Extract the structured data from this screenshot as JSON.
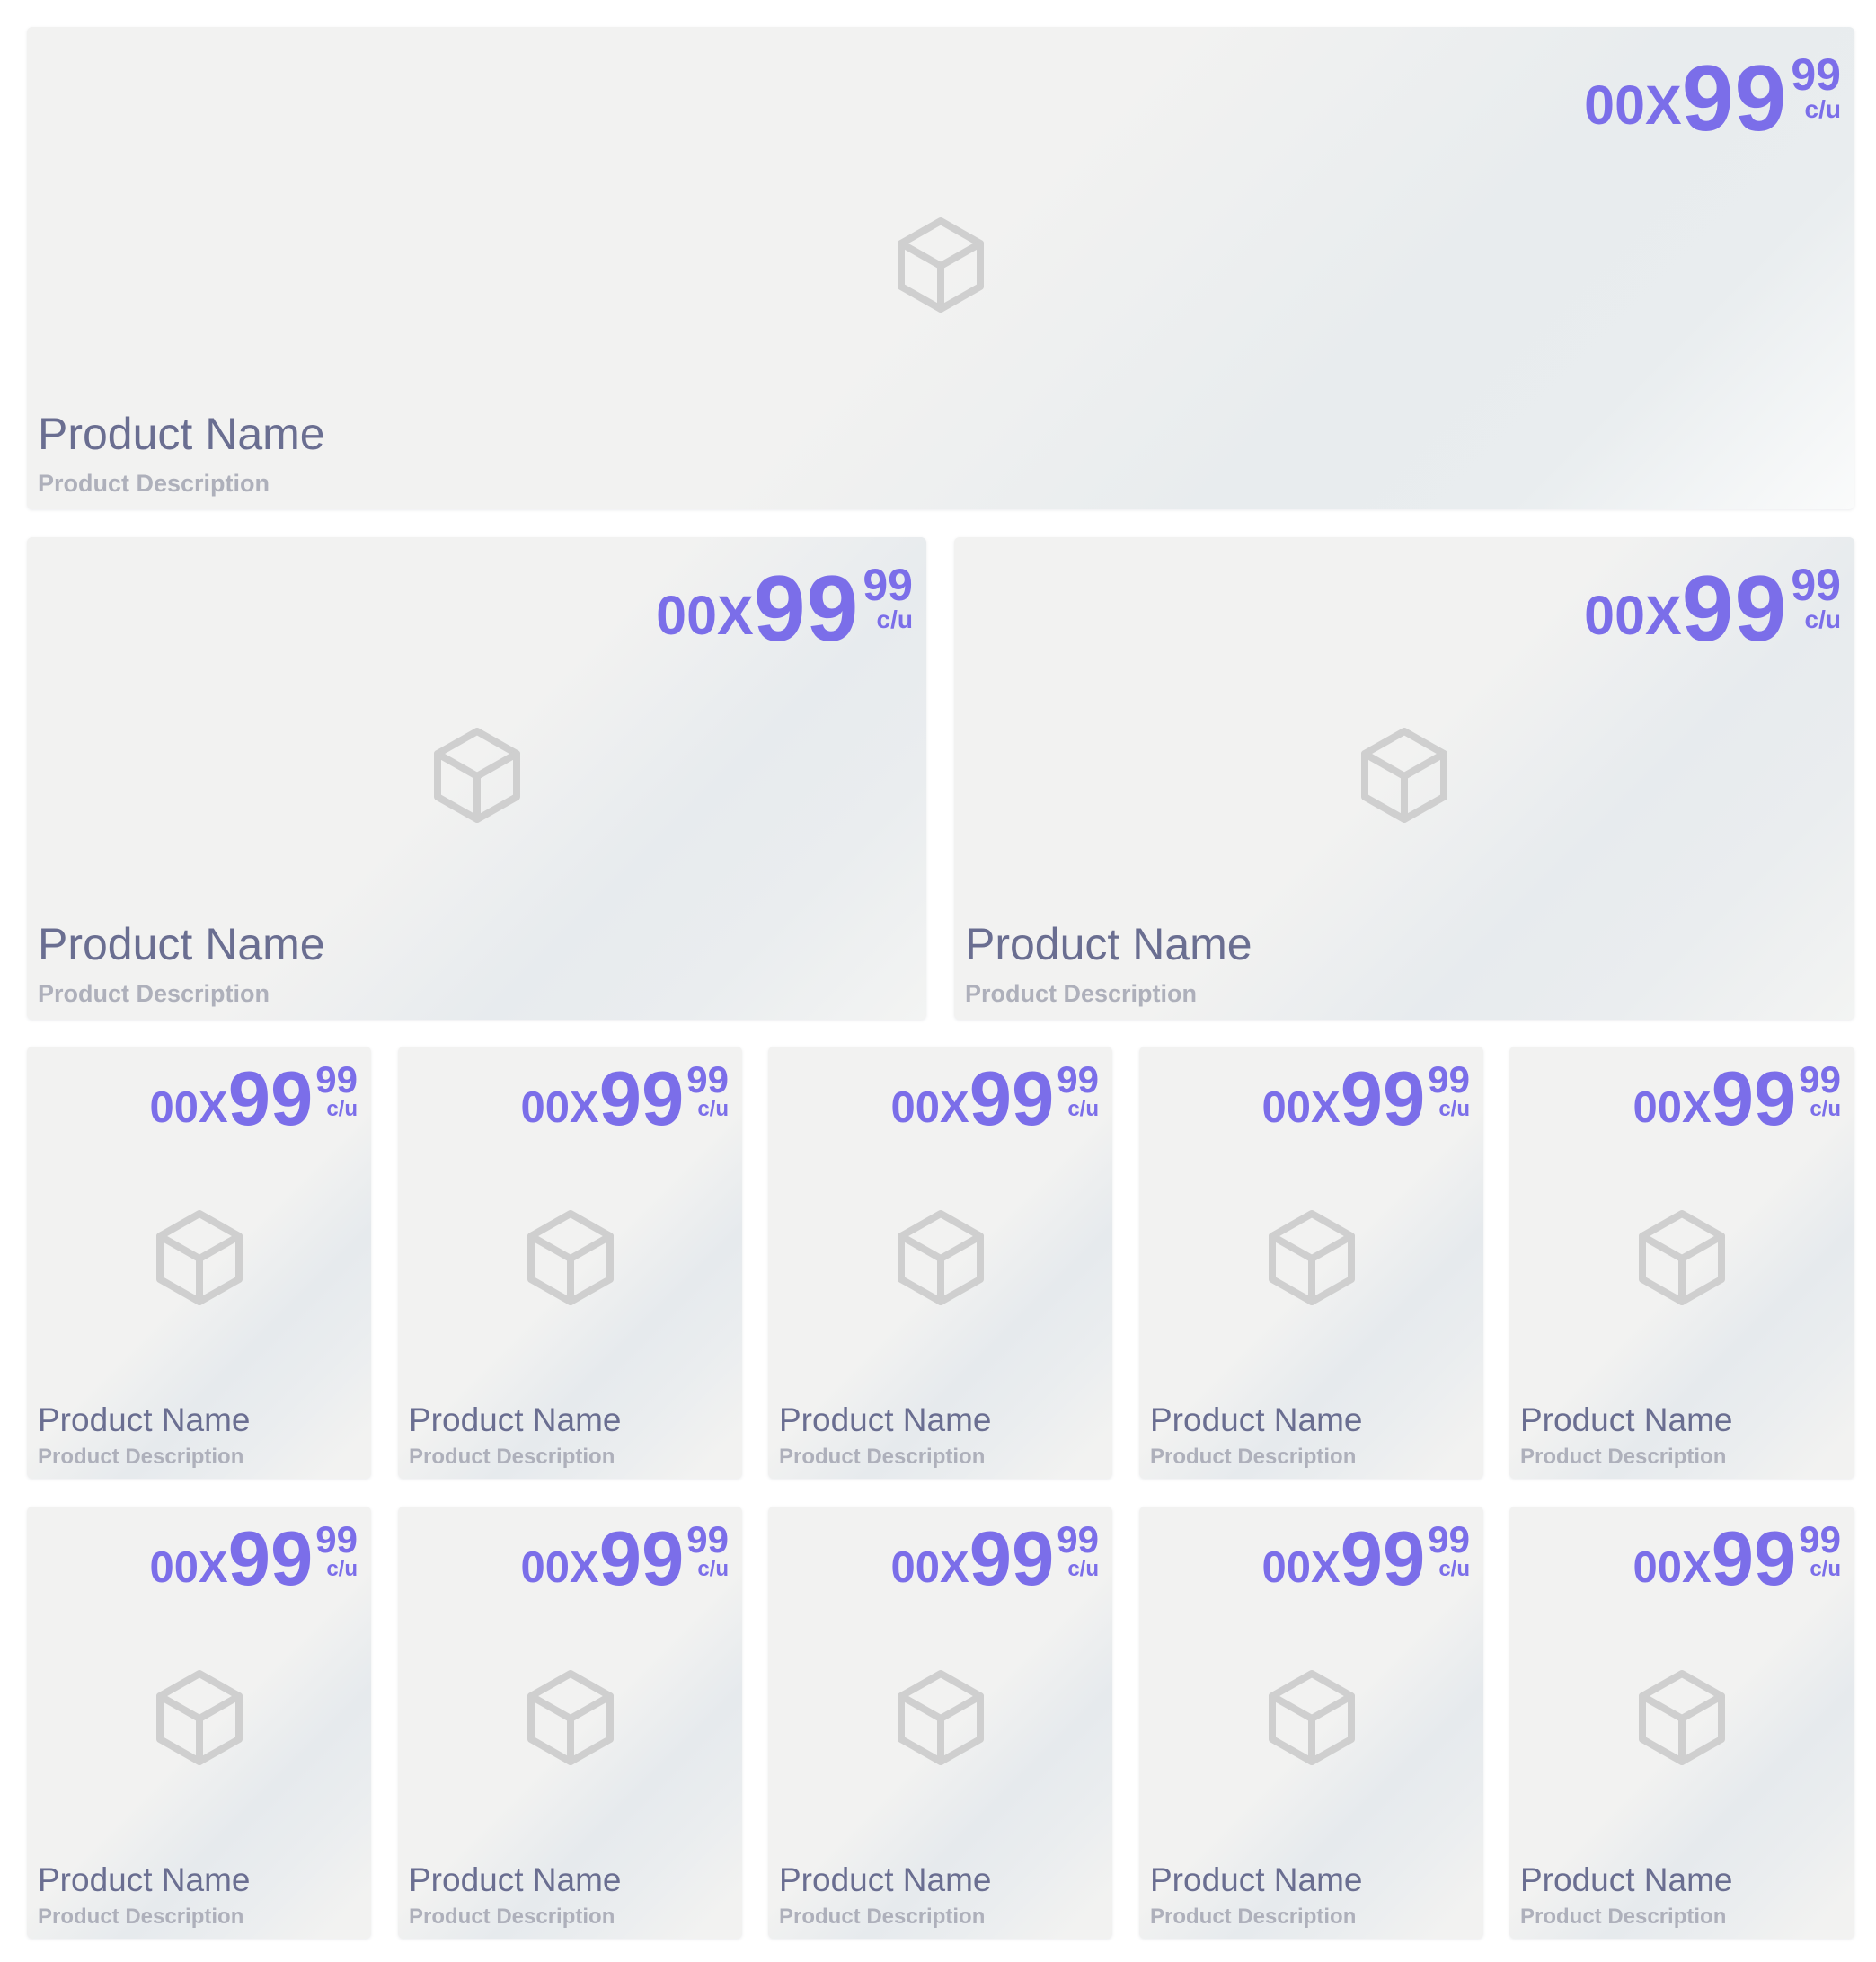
{
  "colors": {
    "price": "#7b6ee9",
    "name": "#6a6e91",
    "description": "#aeb0bb",
    "icon": "#cfcfcf",
    "card_bg": "#f2f2f1"
  },
  "products": [
    {
      "qty": "00X",
      "int": "99",
      "cents": "99",
      "unit": "c/u",
      "name": "Product Name",
      "description": "Product Description",
      "icon": "package-icon"
    },
    {
      "qty": "00X",
      "int": "99",
      "cents": "99",
      "unit": "c/u",
      "name": "Product Name",
      "description": "Product Description",
      "icon": "package-icon"
    },
    {
      "qty": "00X",
      "int": "99",
      "cents": "99",
      "unit": "c/u",
      "name": "Product Name",
      "description": "Product Description",
      "icon": "package-icon"
    },
    {
      "qty": "00X",
      "int": "99",
      "cents": "99",
      "unit": "c/u",
      "name": "Product Name",
      "description": "Product Description",
      "icon": "package-icon"
    },
    {
      "qty": "00X",
      "int": "99",
      "cents": "99",
      "unit": "c/u",
      "name": "Product Name",
      "description": "Product Description",
      "icon": "package-icon"
    },
    {
      "qty": "00X",
      "int": "99",
      "cents": "99",
      "unit": "c/u",
      "name": "Product Name",
      "description": "Product Description",
      "icon": "package-icon"
    },
    {
      "qty": "00X",
      "int": "99",
      "cents": "99",
      "unit": "c/u",
      "name": "Product Name",
      "description": "Product Description",
      "icon": "package-icon"
    },
    {
      "qty": "00X",
      "int": "99",
      "cents": "99",
      "unit": "c/u",
      "name": "Product Name",
      "description": "Product Description",
      "icon": "package-icon"
    },
    {
      "qty": "00X",
      "int": "99",
      "cents": "99",
      "unit": "c/u",
      "name": "Product Name",
      "description": "Product Description",
      "icon": "package-icon"
    },
    {
      "qty": "00X",
      "int": "99",
      "cents": "99",
      "unit": "c/u",
      "name": "Product Name",
      "description": "Product Description",
      "icon": "package-icon"
    },
    {
      "qty": "00X",
      "int": "99",
      "cents": "99",
      "unit": "c/u",
      "name": "Product Name",
      "description": "Product Description",
      "icon": "package-icon"
    },
    {
      "qty": "00X",
      "int": "99",
      "cents": "99",
      "unit": "c/u",
      "name": "Product Name",
      "description": "Product Description",
      "icon": "package-icon"
    },
    {
      "qty": "00X",
      "int": "99",
      "cents": "99",
      "unit": "c/u",
      "name": "Product Name",
      "description": "Product Description",
      "icon": "package-icon"
    }
  ]
}
